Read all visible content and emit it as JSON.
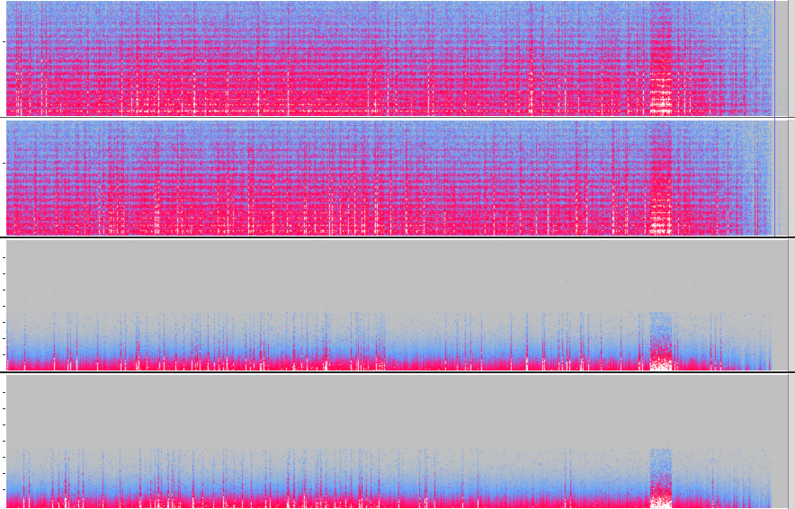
{
  "view": {
    "mode": "spectrogram",
    "palette": [
      "#c0c0c0",
      "#5fa0ff",
      "#ff1a8a",
      "#ff0030",
      "#ffffff"
    ]
  },
  "tracks": [
    {
      "id": "track-1",
      "kind": "spectrogram-full",
      "channel": "left"
    },
    {
      "id": "track-2",
      "kind": "spectrogram-full",
      "channel": "right"
    },
    {
      "id": "track-3",
      "kind": "spectrogram-sparse",
      "channel": "left"
    },
    {
      "id": "track-4",
      "kind": "spectrogram-sparse",
      "channel": "right"
    }
  ]
}
